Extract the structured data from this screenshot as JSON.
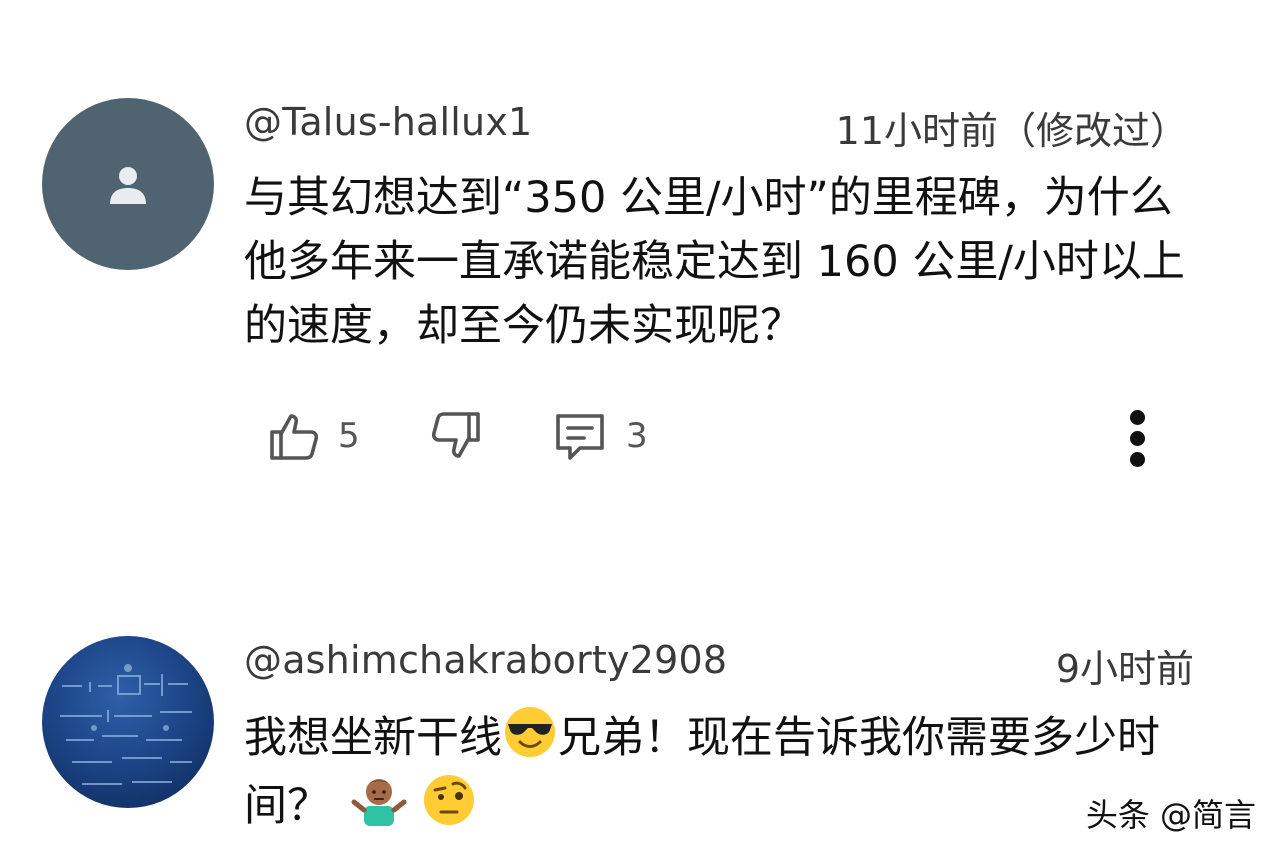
{
  "comments": [
    {
      "username": "@Talus-hallux1",
      "timestamp": "11小时前（修改过）",
      "text": "与其幻想达到“350 公里/小时”的里程碑，为什么他多年来一直承诺能稳定达到 160 公里/小时以上的速度，却至今仍未实现呢？",
      "likes": "5",
      "replies": "3",
      "avatar": "default-person-avatar"
    },
    {
      "username": "@ashimchakraborty2908",
      "timestamp": "9小时前",
      "text_part1": "我想坐新干线",
      "text_part2": "兄弟！现在告诉我你需要多少时间？",
      "emojis": [
        "smiling-face-with-sunglasses",
        "person-shrugging",
        "face-with-raised-eyebrow"
      ],
      "avatar": "blue-photo-avatar"
    }
  ],
  "watermark": "头条 @简言",
  "icons": {
    "like": "thumbs-up-icon",
    "dislike": "thumbs-down-icon",
    "reply": "comment-icon",
    "more": "more-vertical-icon"
  },
  "colors": {
    "default_avatar_bg": "#4f6470",
    "text": "#111111",
    "meta_text": "#3a3a3a"
  }
}
